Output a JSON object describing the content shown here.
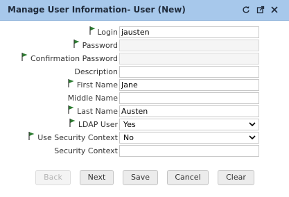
{
  "window": {
    "title": "Manage User Information- User (New)",
    "icons": [
      "refresh-icon",
      "popout-icon",
      "close-icon"
    ]
  },
  "form": {
    "fields": [
      {
        "label": "Login",
        "value": "jausten",
        "required": true
      },
      {
        "label": "Password",
        "value": "",
        "required": true
      },
      {
        "label": "Confirmation Password",
        "value": "",
        "required": true
      },
      {
        "label": "Description",
        "value": "",
        "required": false
      },
      {
        "label": "First Name",
        "value": "Jane",
        "required": true
      },
      {
        "label": "Middle Name",
        "value": "",
        "required": false
      },
      {
        "label": "Last Name",
        "value": "Austen",
        "required": true
      },
      {
        "label": "LDAP User",
        "value": "Yes",
        "required": true
      },
      {
        "label": "Use Security Context",
        "value": "No",
        "required": true
      },
      {
        "label": "Security Context",
        "value": "",
        "required": false
      }
    ]
  },
  "buttons": {
    "back": "Back",
    "next": "Next",
    "save": "Save",
    "cancel": "Cancel",
    "clear": "Clear"
  },
  "colors": {
    "titlebar": "#a7c8eb",
    "required_flag": "#2e7d32"
  }
}
